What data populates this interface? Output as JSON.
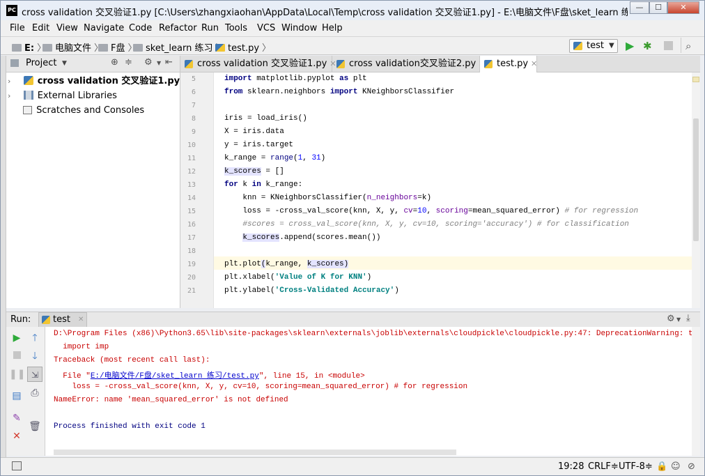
{
  "window": {
    "title": "cross validation 交叉验证1.py [C:\\Users\\zhangxiaohan\\AppData\\Local\\Temp\\cross validation 交叉验证1.py] - E:\\电脑文件\\F盘\\sket_learn 练习\\test.py - P...",
    "app_badge": "PC",
    "min": "—",
    "max": "☐",
    "close": "✕"
  },
  "menu": [
    "File",
    "Edit",
    "View",
    "Navigate",
    "Code",
    "Refactor",
    "Run",
    "Tools",
    "VCS",
    "Window",
    "Help"
  ],
  "breadcrumbs": [
    "E:",
    "电脑文件",
    "F盘",
    "sket_learn 练习",
    "test.py"
  ],
  "run_config": "test",
  "project_panel": {
    "title": "Project",
    "items": [
      "cross validation 交叉验证1.py",
      "External Libraries",
      "Scratches and Consoles"
    ]
  },
  "tabs": [
    {
      "label": "cross validation 交叉验证1.py",
      "active": false
    },
    {
      "label": "cross validation交叉验证2.py",
      "active": false
    },
    {
      "label": "test.py",
      "active": true
    }
  ],
  "editor": {
    "line_numbers": [
      "5",
      "6",
      "7",
      "8",
      "9",
      "10",
      "11",
      "12",
      "13",
      "14",
      "15",
      "16",
      "17",
      "18",
      "19",
      "20",
      "21"
    ],
    "current_line": "19"
  },
  "run_panel": {
    "label": "Run:",
    "tab": "test",
    "console": {
      "line1": "D:\\Program Files (x86)\\Python3.65\\lib\\site-packages\\sklearn\\externals\\joblib\\externals\\cloudpickle\\cloudpickle.py:47: DeprecationWarning: the imp module is",
      "line2": "  import imp",
      "line3": "Traceback (most recent call last):",
      "line4_pre": "  File \"",
      "line4_link": "E:/电脑文件/F盘/sket_learn 练习/test.py",
      "line4_post": "\", line 15, in <module>",
      "line5": "    loss = -cross_val_score(knn, X, y, cv=10, scoring=mean_squared_error) # for regression",
      "line6": "NameError: name 'mean_squared_error' is not defined",
      "line7": "Process finished with exit code 1"
    }
  },
  "status": {
    "position": "19:28",
    "line_sep": "CRLF≑",
    "encoding": "UTF-8≑"
  }
}
